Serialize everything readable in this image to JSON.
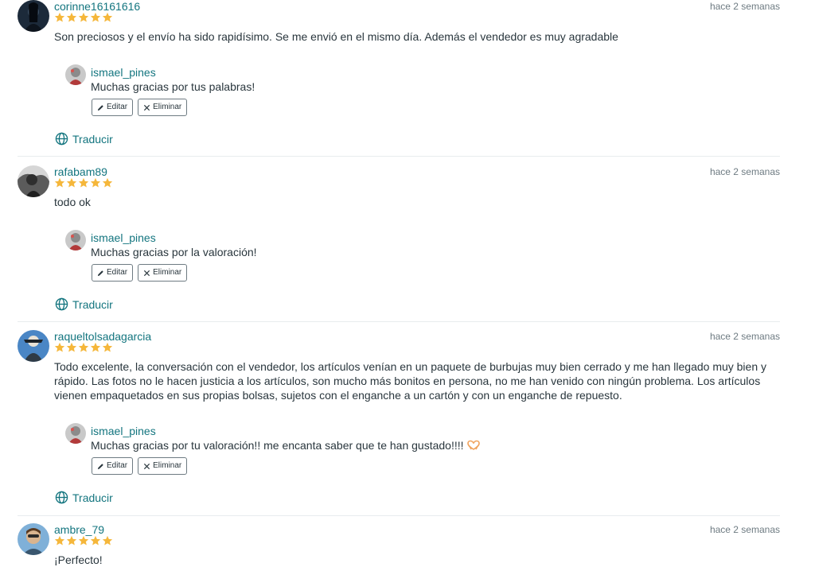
{
  "theme": {
    "accent": "#13757f",
    "star": "#f5b73b",
    "text": "#29363d",
    "muted": "#6e7b82"
  },
  "reviews": [
    {
      "author": "corinne16161616",
      "rating": 5,
      "date": "hace 2 semanas",
      "text": "Son preciosos y el envío ha sido rapidísimo. Se me envió en el mismo día. Además el vendedor es muy agradable",
      "reply": {
        "author": "ismael_pines",
        "text": "Muchas gracias por tus palabras!",
        "edit_label": "Editar",
        "delete_label": "Eliminar"
      },
      "translate_label": "Traducir"
    },
    {
      "author": "rafabam89",
      "rating": 5,
      "date": "hace 2 semanas",
      "text": "todo ok",
      "reply": {
        "author": "ismael_pines",
        "text": "Muchas gracias por la valoración!",
        "edit_label": "Editar",
        "delete_label": "Eliminar"
      },
      "translate_label": "Traducir"
    },
    {
      "author": "raqueltolsadagarcia",
      "rating": 5,
      "date": "hace 2 semanas",
      "text": "Todo excelente, la conversación con el vendedor, los artículos venían en un paquete de burbujas muy bien cerrado y me han llegado muy bien y rápido. Las fotos no le hacen justicia a los artículos, son mucho más bonitos en persona, no me han venido con ningún problema. Los artículos vienen empaquetados en sus propias bolsas, sujetos con el enganche a un cartón y con un enganche de repuesto.",
      "reply": {
        "author": "ismael_pines",
        "text": "Muchas gracias por tu valoración!! me encanta saber que te han gustado!!!!",
        "emoji": "heart-hands-icon",
        "edit_label": "Editar",
        "delete_label": "Eliminar"
      },
      "translate_label": "Traducir"
    },
    {
      "author": "ambre_79",
      "rating": 5,
      "date": "hace 2 semanas",
      "text": "¡Perfecto!"
    }
  ]
}
